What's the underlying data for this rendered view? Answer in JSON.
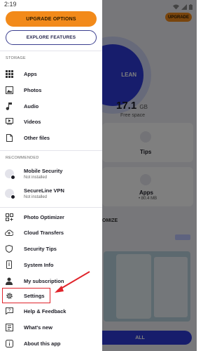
{
  "status_bar": {
    "time": "2:19"
  },
  "background": {
    "upgrade_label": "UPGRADE",
    "clean_label": "LEAN",
    "free_space_value": "17.1",
    "free_space_unit": "GB",
    "free_space_label": "Free space",
    "tips_label": "Tips",
    "apps_label": "Apps",
    "apps_size": "• 80.4 MB",
    "optimize_label": "OMIZE",
    "bottom_button_label": "ALL"
  },
  "drawer": {
    "upgrade_button": "UPGRADE OPTIONS",
    "explore_button": "EXPLORE FEATURES",
    "storage_section": "STORAGE",
    "storage_items": [
      {
        "label": "Apps",
        "icon": "apps-grid-icon"
      },
      {
        "label": "Photos",
        "icon": "photo-icon"
      },
      {
        "label": "Audio",
        "icon": "music-note-icon"
      },
      {
        "label": "Videos",
        "icon": "video-icon"
      },
      {
        "label": "Other files",
        "icon": "file-icon"
      }
    ],
    "recommended_section": "RECOMMENDED",
    "recommended_items": [
      {
        "label": "Mobile Security",
        "status": "Not installed",
        "icon": "mobile-security-icon"
      },
      {
        "label": "SecureLine VPN",
        "status": "Not installed",
        "icon": "vpn-icon"
      }
    ],
    "tool_items": [
      {
        "label": "Photo Optimizer",
        "icon": "photo-optimizer-icon"
      },
      {
        "label": "Cloud Transfers",
        "icon": "cloud-upload-icon"
      },
      {
        "label": "Security Tips",
        "icon": "shield-icon"
      },
      {
        "label": "System Info",
        "icon": "phone-info-icon"
      },
      {
        "label": "My subscription",
        "icon": "person-icon"
      },
      {
        "label": "Settings",
        "icon": "gear-icon"
      },
      {
        "label": "Help & Feedback",
        "icon": "help-icon"
      },
      {
        "label": "What's new",
        "icon": "new-icon"
      },
      {
        "label": "About this app",
        "icon": "info-icon"
      }
    ]
  },
  "colors": {
    "accent_orange": "#f28a1a",
    "brand_blue": "#2f3ad8",
    "highlight_red": "#e0242b"
  }
}
